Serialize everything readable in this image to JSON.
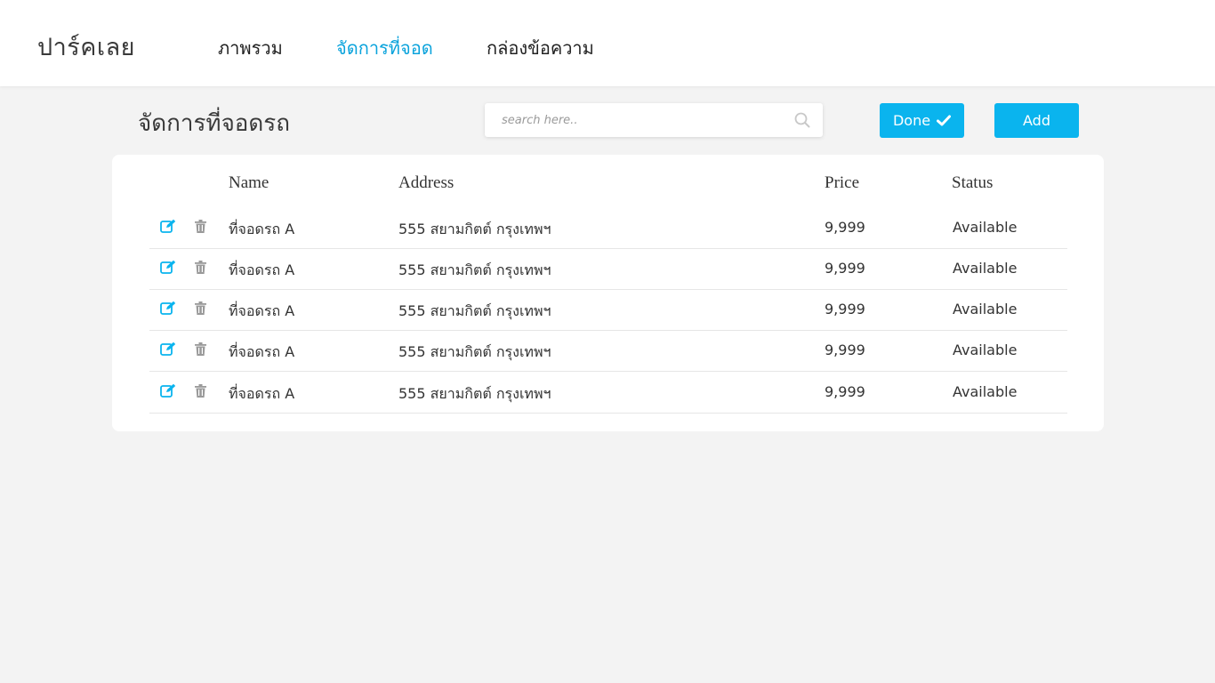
{
  "app": {
    "logo": "ปาร์คเลย"
  },
  "nav": {
    "items": [
      {
        "label": "ภาพรวม"
      },
      {
        "label": "จัดการที่จอด"
      },
      {
        "label": "กล่องข้อความ"
      }
    ]
  },
  "page": {
    "title": "จัดการที่จอดรถ"
  },
  "search": {
    "placeholder": "search here..",
    "value": "",
    "icon": "search-icon"
  },
  "toolbar": {
    "done_label": "Done",
    "done_icon": "check-icon",
    "add_label": "Add"
  },
  "table": {
    "columns": [
      "Name",
      "Address",
      "Price",
      "Status"
    ],
    "rows": [
      {
        "name": "ที่จอดรถ A",
        "address": "555 สยามกิตต์ กรุงเทพฯ",
        "price": "9,999",
        "status": "Available"
      },
      {
        "name": "ที่จอดรถ A",
        "address": "555 สยามกิตต์ กรุงเทพฯ",
        "price": "9,999",
        "status": "Available"
      },
      {
        "name": "ที่จอดรถ A",
        "address": "555 สยามกิตต์ กรุงเทพฯ",
        "price": "9,999",
        "status": "Available"
      },
      {
        "name": "ที่จอดรถ A",
        "address": "555 สยามกิตต์ กรุงเทพฯ",
        "price": "9,999",
        "status": "Available"
      },
      {
        "name": "ที่จอดรถ A",
        "address": "555 สยามกิตต์ กรุงเทพฯ",
        "price": "9,999",
        "status": "Available"
      }
    ],
    "row_icons": [
      "edit-icon",
      "trash-icon"
    ]
  },
  "colors": {
    "accent": "#0ab4ee",
    "nav_active": "#0aa3dc",
    "background": "#f3f3f3",
    "trash_icon": "#9a9a9a"
  }
}
